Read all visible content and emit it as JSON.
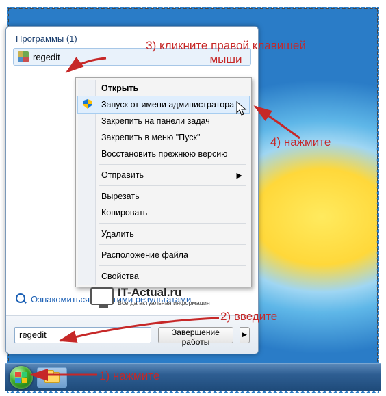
{
  "startmenu": {
    "programs_header": "Программы (1)",
    "result_name": "regedit",
    "see_all": "Ознакомиться с другими результатами",
    "search_value": "regedit",
    "shutdown_label": "Завершение работы"
  },
  "context_menu": {
    "items": [
      {
        "label": "Открыть",
        "bold": true
      },
      {
        "label": "Запуск от имени администратора",
        "shield": true,
        "hover": true
      },
      {
        "label": "Закрепить на панели задач"
      },
      {
        "label": "Закрепить в меню \"Пуск\""
      },
      {
        "label": "Восстановить прежнюю версию"
      },
      {
        "sep": true
      },
      {
        "label": "Отправить",
        "submenu": true
      },
      {
        "sep": true
      },
      {
        "label": "Вырезать"
      },
      {
        "label": "Копировать"
      },
      {
        "sep": true
      },
      {
        "label": "Удалить"
      },
      {
        "sep": true
      },
      {
        "label": "Расположение файла"
      },
      {
        "sep": true
      },
      {
        "label": "Свойства"
      }
    ]
  },
  "annotations": {
    "step1": "1) нажмите",
    "step2": "2) введите",
    "step3": "3) кликните правой клавишей мыши",
    "step4": "4) нажмите"
  },
  "watermark": {
    "title": "IT-Actual.ru",
    "subtitle": "Всегда актуальная информация"
  }
}
